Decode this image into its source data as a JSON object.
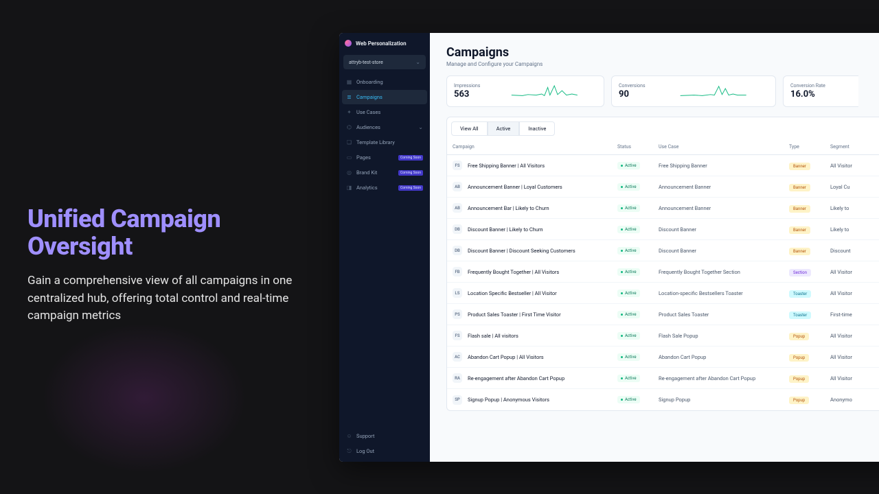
{
  "hero": {
    "title": "Unified Campaign Oversight",
    "body": "Gain a comprehensive view of all campaigns in one centralized hub, offering total control and real-time campaign metrics"
  },
  "brand": "Web Personalization",
  "store": "attryb-test-store",
  "nav": {
    "onboarding": "Onboarding",
    "campaigns": "Campaigns",
    "usecases": "Use Cases",
    "audiences": "Audiences",
    "templates": "Template Library",
    "pages": "Pages",
    "brandkit": "Brand Kit",
    "analytics": "Analytics",
    "support": "Support",
    "logout": "Log Out",
    "soon": "Coming Soon"
  },
  "page": {
    "title": "Campaigns",
    "subtitle": "Manage and Configure your Campaigns"
  },
  "stats": {
    "impressions_label": "Impressions",
    "impressions_value": "563",
    "conversions_label": "Conversions",
    "conversions_value": "90",
    "rate_label": "Conversion Rate",
    "rate_value": "16.0%"
  },
  "tabs": {
    "all": "View All",
    "active": "Active",
    "inactive": "Inactive"
  },
  "columns": {
    "campaign": "Campaign",
    "status": "Status",
    "usecase": "Use Case",
    "type": "Type",
    "segment": "Segment"
  },
  "status_active": "Active",
  "rows": [
    {
      "init": "FS",
      "name": "Free Shipping Banner | All Visitors",
      "usecase": "Free Shipping Banner",
      "type": "Banner",
      "segment": "All Visitor"
    },
    {
      "init": "AB",
      "name": "Announcement Banner | Loyal Customers",
      "usecase": "Announcement Banner",
      "type": "Banner",
      "segment": "Loyal Cu"
    },
    {
      "init": "AB",
      "name": "Announcement Bar | Likely to Churn",
      "usecase": "Announcement Banner",
      "type": "Banner",
      "segment": "Likely to"
    },
    {
      "init": "DB",
      "name": "Discount Banner | Likely to Churn",
      "usecase": "Discount Banner",
      "type": "Banner",
      "segment": "Likely to"
    },
    {
      "init": "DB",
      "name": "Discount Banner | Discount Seeking Customers",
      "usecase": "Discount Banner",
      "type": "Banner",
      "segment": "Discount"
    },
    {
      "init": "FB",
      "name": "Frequently Bought Together | All Visitors",
      "usecase": "Frequently Bought Together Section",
      "type": "Section",
      "segment": "All Visitor"
    },
    {
      "init": "LS",
      "name": "Location Specific Bestseller | All Visitor",
      "usecase": "Location-specific Bestsellers Toaster",
      "type": "Toaster",
      "segment": "All Visitor"
    },
    {
      "init": "PS",
      "name": "Product Sales Toaster | First Time Visitor",
      "usecase": "Product Sales Toaster",
      "type": "Toaster",
      "segment": "First-time"
    },
    {
      "init": "FS",
      "name": "Flash sale | All visitors",
      "usecase": "Flash Sale Popup",
      "type": "Popup",
      "segment": "All Visitor"
    },
    {
      "init": "AC",
      "name": "Abandon Cart Popup | All Visitors",
      "usecase": "Abandon Cart Popup",
      "type": "Popup",
      "segment": "All Visitor"
    },
    {
      "init": "RA",
      "name": "Re-engagement after Abandon Cart Popup",
      "usecase": "Re-engagement after Abandon Cart Popup",
      "type": "Popup",
      "segment": "All Visitor"
    },
    {
      "init": "SP",
      "name": "Signup Popup | Anonymous Visitors",
      "usecase": "Signup Popup",
      "type": "Popup",
      "segment": "Anonymo"
    }
  ]
}
